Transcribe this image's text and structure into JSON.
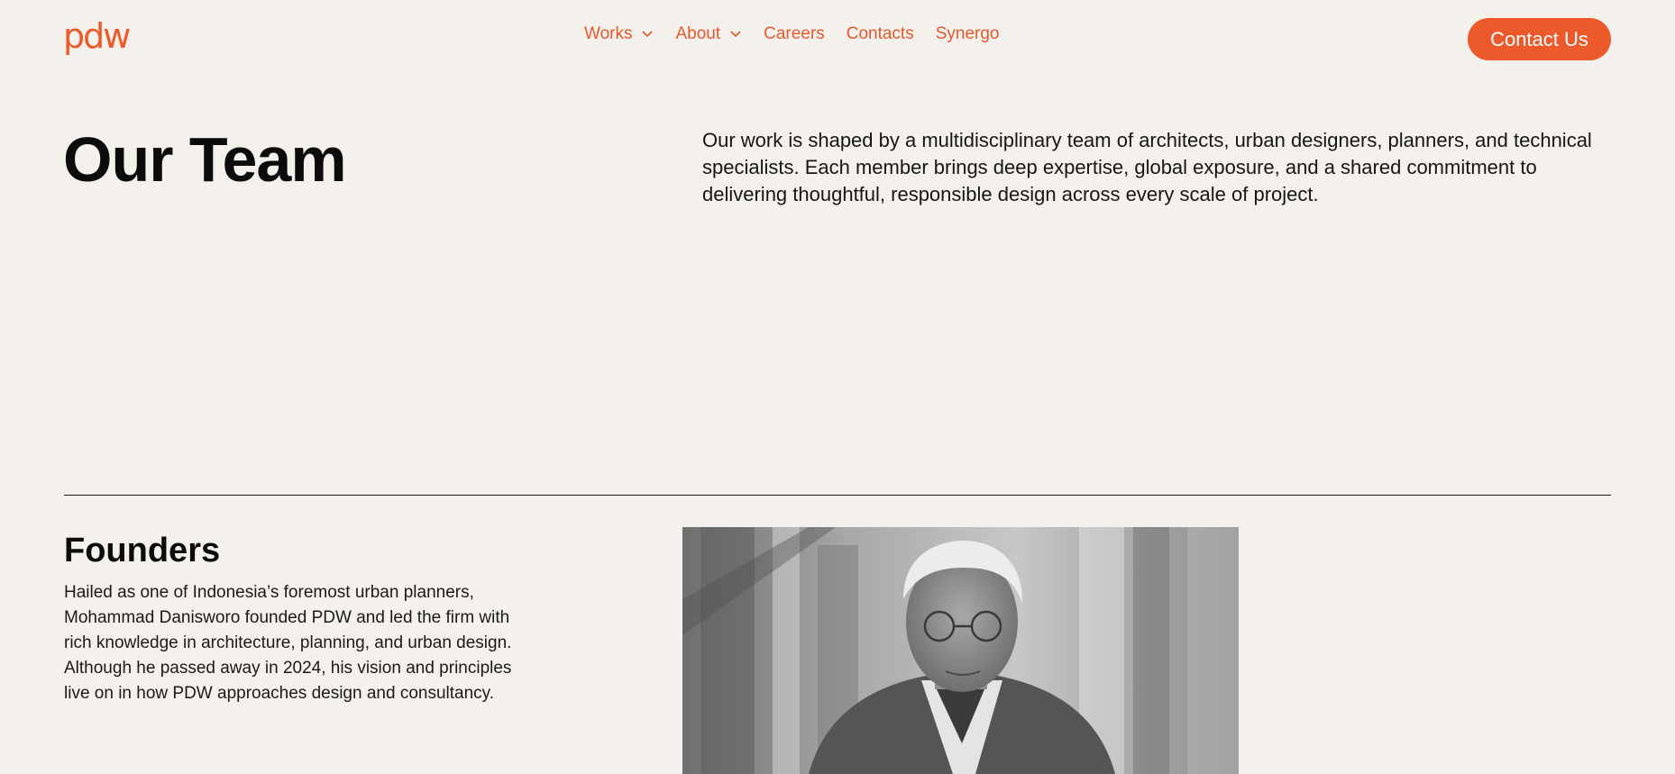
{
  "header": {
    "logo_text": "pdw",
    "nav": [
      {
        "label": "Works",
        "has_dropdown": true
      },
      {
        "label": "About",
        "has_dropdown": true
      },
      {
        "label": "Careers",
        "has_dropdown": false
      },
      {
        "label": "Contacts",
        "has_dropdown": false
      },
      {
        "label": "Synergo",
        "has_dropdown": false
      }
    ],
    "cta_label": "Contact Us"
  },
  "hero": {
    "title": "Our Team",
    "description": "Our work is shaped by a multidisciplinary team of architects, urban designers, planners, and technical specialists. Each member brings deep expertise, global exposure, and a shared commitment to delivering thoughtful, responsible design across every scale of project."
  },
  "founders": {
    "title": "Founders",
    "description": "Hailed as one of Indonesia’s foremost urban planners, Mohammad Danisworo founded PDW and led the firm with rich knowledge in architecture, planning, and urban design. Although he passed away in 2024, his vision and principles live on in how PDW approaches design and consultancy.",
    "photo_style": "grayscale portrait"
  },
  "colors": {
    "background": "#f4f1ec",
    "accent": "#ea5a2b",
    "text": "#111111"
  },
  "icons": {
    "dropdown": "chevron-down-icon"
  }
}
